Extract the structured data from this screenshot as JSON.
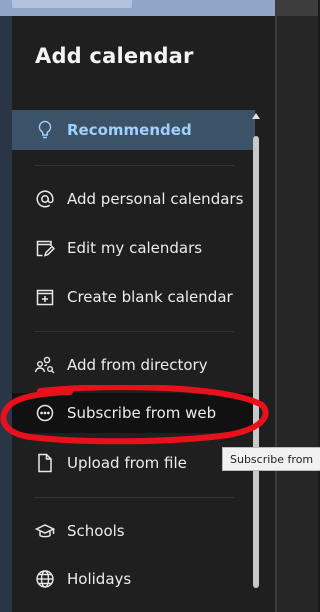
{
  "panel": {
    "title": "Add calendar",
    "items": [
      {
        "label": "Recommended",
        "icon": "lightbulb-icon",
        "state": "selected"
      },
      {
        "label": "Add personal calendars",
        "icon": "at-sign-icon"
      },
      {
        "label": "Edit my calendars",
        "icon": "edit-calendar-icon"
      },
      {
        "label": "Create blank calendar",
        "icon": "calendar-add-icon"
      },
      {
        "label": "Add from directory",
        "icon": "people-search-icon"
      },
      {
        "label": "Subscribe from web",
        "icon": "subscribe-circle-icon",
        "state": "hovered"
      },
      {
        "label": "Upload from file",
        "icon": "file-upload-icon"
      },
      {
        "label": "Schools",
        "icon": "school-icon"
      },
      {
        "label": "Holidays",
        "icon": "globe-icon"
      }
    ]
  },
  "tooltip": {
    "text": "Subscribe from"
  },
  "colors": {
    "panel_bg": "#1f1f1f",
    "selected_bg": "#3c5266",
    "selected_text": "#9fd0ff",
    "highlight_ring": "#e8111b"
  }
}
